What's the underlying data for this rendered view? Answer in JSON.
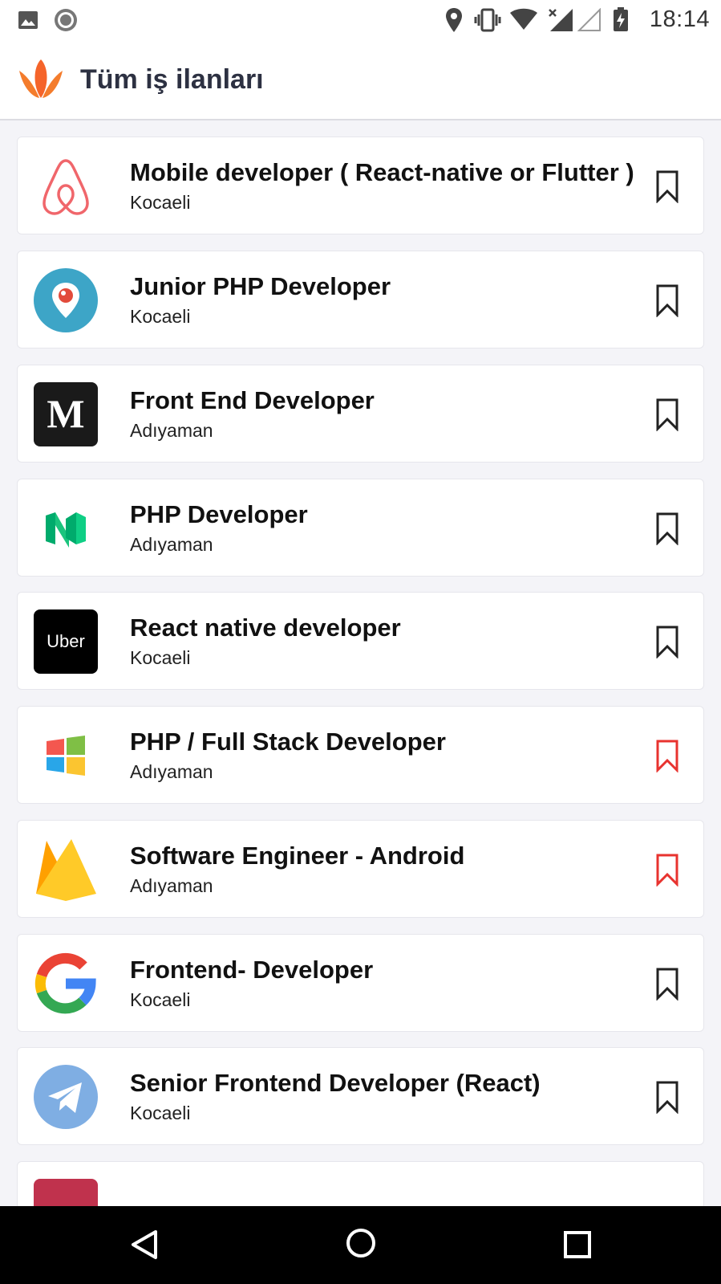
{
  "status_bar": {
    "time": "18:14",
    "icons": [
      "image-icon",
      "record-icon",
      "location-icon",
      "vibrate-icon",
      "wifi-icon",
      "signal-icon",
      "signal-empty-icon",
      "battery-charging-icon"
    ]
  },
  "app_bar": {
    "title": "Tüm iş ilanları",
    "logo_icon": "lotus-logo-icon",
    "accent_color": "#f5642a"
  },
  "jobs": [
    {
      "title": "Mobile developer ( React-native or Flutter )",
      "location": "Kocaeli",
      "company_logo": "airbnb-logo",
      "bookmarked": false
    },
    {
      "title": "Junior PHP Developer",
      "location": "Kocaeli",
      "company_logo": "periscope-logo",
      "bookmarked": false
    },
    {
      "title": "Front End Developer",
      "location": "Adıyaman",
      "company_logo": "medium-logo",
      "bookmarked": false
    },
    {
      "title": "PHP Developer",
      "location": "Adıyaman",
      "company_logo": "medium-green-logo",
      "bookmarked": false
    },
    {
      "title": "React native developer",
      "location": "Kocaeli",
      "company_logo": "uber-logo",
      "logo_text": "Uber",
      "bookmarked": false
    },
    {
      "title": "PHP / Full Stack Developer",
      "location": "Adıyaman",
      "company_logo": "windows-logo",
      "bookmarked": true
    },
    {
      "title": "Software Engineer - Android",
      "location": "Adıyaman",
      "company_logo": "firebase-logo",
      "bookmarked": true
    },
    {
      "title": "Frontend- Developer",
      "location": "Kocaeli",
      "company_logo": "google-logo",
      "bookmarked": false
    },
    {
      "title": "Senior Frontend Developer (React)",
      "location": "Kocaeli",
      "company_logo": "telegram-logo",
      "bookmarked": false
    }
  ],
  "bookmark_colors": {
    "default": "#222222",
    "active": "#e8332f"
  },
  "nav_bar": {
    "buttons": [
      "back-icon",
      "home-icon",
      "recents-icon"
    ]
  }
}
